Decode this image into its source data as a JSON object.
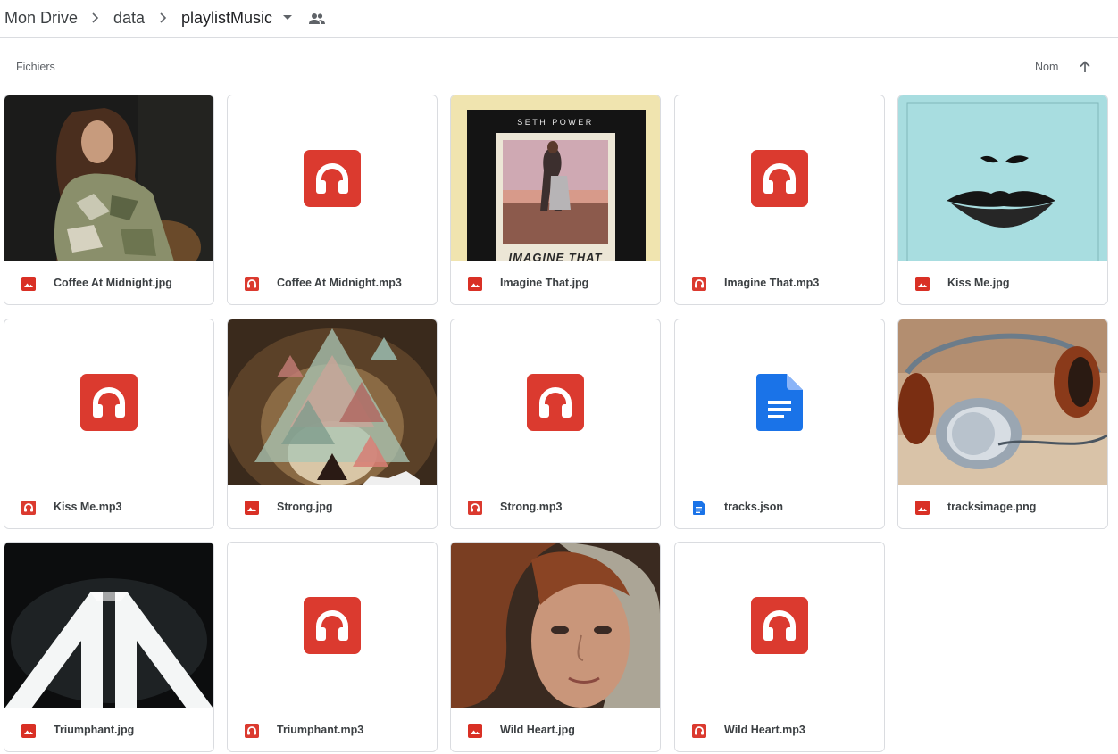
{
  "breadcrumb": {
    "root": "Mon Drive",
    "middle": "data",
    "current": "playlistMusic"
  },
  "section_label": "Fichiers",
  "sort": {
    "label": "Nom",
    "direction": "ascending"
  },
  "colors": {
    "audio_red": "#db3a2f",
    "image_red": "#d93025",
    "doc_blue": "#1a73e8"
  },
  "files": [
    {
      "name": "Coffee At Midnight.jpg",
      "type": "image",
      "icon": "image-icon"
    },
    {
      "name": "Coffee At Midnight.mp3",
      "type": "audio",
      "icon": "headphones-icon"
    },
    {
      "name": "Imagine That.jpg",
      "type": "image",
      "icon": "image-icon"
    },
    {
      "name": "Imagine That.mp3",
      "type": "audio",
      "icon": "headphones-icon"
    },
    {
      "name": "Kiss Me.jpg",
      "type": "image",
      "icon": "image-icon"
    },
    {
      "name": "Kiss Me.mp3",
      "type": "audio",
      "icon": "headphones-icon"
    },
    {
      "name": "Strong.jpg",
      "type": "image",
      "icon": "image-icon"
    },
    {
      "name": "Strong.mp3",
      "type": "audio",
      "icon": "headphones-icon"
    },
    {
      "name": "tracks.json",
      "type": "document",
      "icon": "document-icon"
    },
    {
      "name": "tracksimage.png",
      "type": "image",
      "icon": "image-icon"
    },
    {
      "name": "Triumphant.jpg",
      "type": "image",
      "icon": "image-icon"
    },
    {
      "name": "Triumphant.mp3",
      "type": "audio",
      "icon": "headphones-icon"
    },
    {
      "name": "Wild Heart.jpg",
      "type": "image",
      "icon": "image-icon"
    },
    {
      "name": "Wild Heart.mp3",
      "type": "audio",
      "icon": "headphones-icon"
    }
  ],
  "thumbnail_text": {
    "imagine_artist": "SETH POWER",
    "imagine_title": "IMAGINE THAT"
  }
}
